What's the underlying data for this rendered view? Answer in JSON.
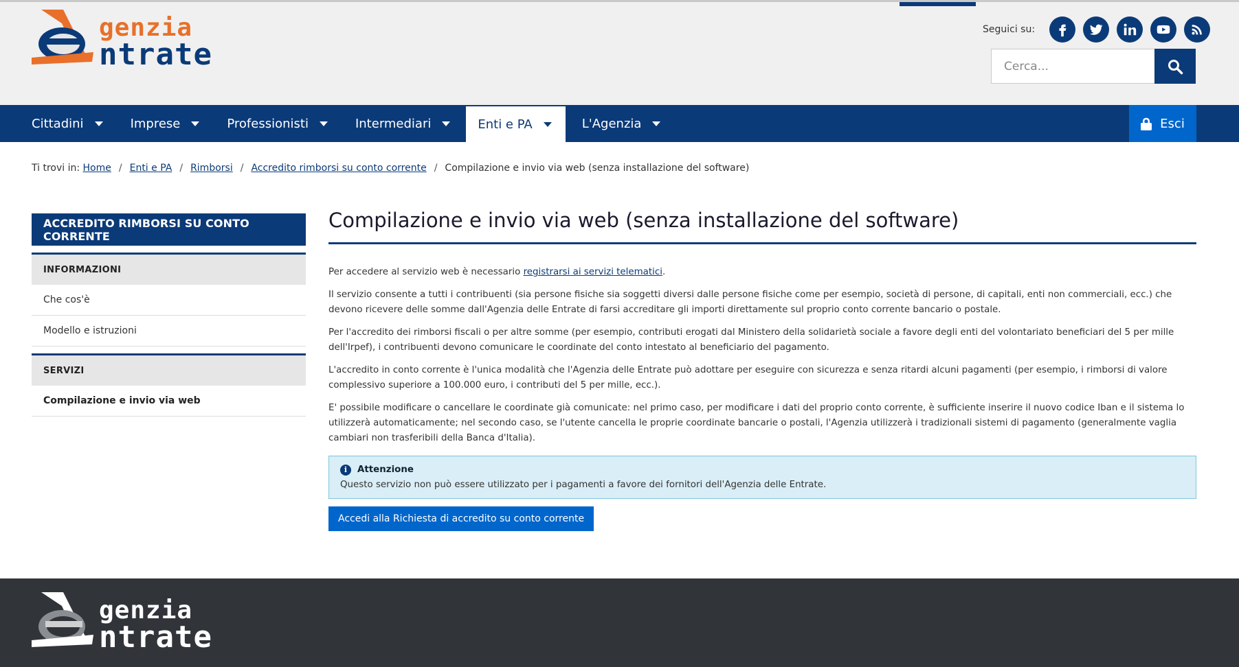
{
  "logo": {
    "line1": "genzia",
    "line2": "ntrate"
  },
  "header": {
    "follow_label": "Seguici su:",
    "social": [
      "facebook-icon",
      "twitter-icon",
      "linkedin-icon",
      "youtube-icon",
      "rss-icon"
    ],
    "search_placeholder": "Cerca..."
  },
  "nav": {
    "items": [
      {
        "label": "Cittadini"
      },
      {
        "label": "Imprese"
      },
      {
        "label": "Professionisti"
      },
      {
        "label": "Intermediari"
      },
      {
        "label": "Enti e PA"
      },
      {
        "label": "L'Agenzia"
      }
    ],
    "active": "Enti e PA",
    "logout_label": "Esci"
  },
  "breadcrumb": {
    "prefix": "Ti trovi in:",
    "links": [
      "Home",
      "Enti e PA",
      "Rimborsi",
      "Accredito rimborsi su conto corrente"
    ],
    "current": "Compilazione e invio via web (senza installazione del software)"
  },
  "sidebar": {
    "title": "ACCREDITO RIMBORSI SU CONTO CORRENTE",
    "sections": [
      {
        "heading": "INFORMAZIONI",
        "links": [
          "Che cos'è",
          "Modello e istruzioni"
        ]
      },
      {
        "heading": "SERVIZI",
        "links": [
          "Compilazione e invio via web"
        ]
      }
    ]
  },
  "main": {
    "title": "Compilazione e invio via web (senza installazione del software)",
    "p1_before": "Per accedere al servizio web è necessario ",
    "p1_link": "registrarsi ai servizi telematici",
    "p1_after": ".",
    "p2": "Il servizio consente a tutti i contribuenti (sia persone fisiche sia soggetti diversi dalle persone fisiche come per esempio, società di persone, di capitali, enti non commerciali, ecc.) che devono ricevere delle somme dall'Agenzia delle Entrate di farsi accreditare gli importi direttamente sul proprio conto corrente bancario o postale.",
    "p3": "Per l'accredito dei rimborsi fiscali o per altre somme (per esempio, contributi erogati dal Ministero della solidarietà sociale a favore degli enti del volontariato beneficiari del 5 per mille dell'Irpef), i contribuenti devono comunicare le coordinate del conto intestato al beneficiario del pagamento.",
    "p4": "L'accredito in conto corrente è l'unica modalità che l'Agenzia delle Entrate può adottare per eseguire con sicurezza e senza ritardi alcuni pagamenti (per esempio, i rimborsi di valore complessivo superiore a 100.000 euro, i contributi del 5 per mille, ecc.).",
    "p5": "E' possibile modificare o cancellare le coordinate già comunicate: nel primo caso, per modificare i dati del proprio conto corrente, è sufficiente inserire il nuovo codice Iban e il sistema lo utilizzerà automaticamente; nel secondo caso, se l'utente cancella le proprie coordinate bancarie o postali, l'Agenzia utilizzerà i tradizionali sistemi di pagamento (generalmente vaglia cambiari non trasferibili della Banca d'Italia).",
    "alert_title": "Attenzione",
    "alert_text": "Questo servizio non può essere utilizzato per i pagamenti a favore dei fornitori dell'Agenzia delle Entrate.",
    "cta_label": "Accedi alla Richiesta di accredito su conto corrente"
  },
  "colors": {
    "primary": "#0b3a78",
    "accent_button": "#0066cc",
    "logo_orange": "#e8702a",
    "footer_bg": "#31353a",
    "alert_bg": "#d9eef6"
  }
}
